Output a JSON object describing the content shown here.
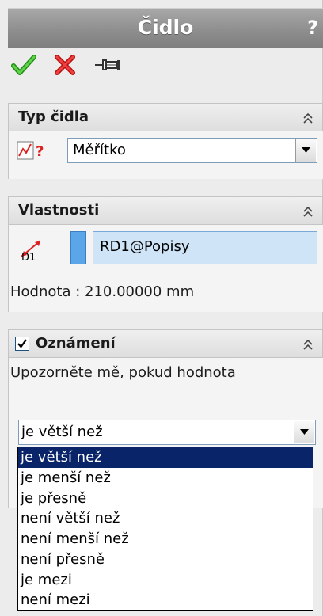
{
  "panel": {
    "title": "Čidlo",
    "help_label": "?"
  },
  "toolbar": {
    "ok_icon": "checkmark-icon",
    "cancel_icon": "x-icon",
    "pin_icon": "pushpin-icon"
  },
  "sensor_type": {
    "header": "Typ čidla",
    "icon": "sensor-graph-icon",
    "selected": "Měřítko"
  },
  "properties": {
    "header": "Vlastnosti",
    "dimension_icon": "dimension-icon",
    "dimension_icon_label": "D1",
    "dimension_value": "RD1@Popisy",
    "value_text": "Hodnota : 210.00000 mm"
  },
  "notification": {
    "header": "Oznámení",
    "checked": true,
    "description": "Upozorněte mě, pokud hodnota",
    "condition_selected": "je větší než",
    "options": [
      "je větší než",
      "je menší než",
      "je přesně",
      "není větší než",
      "není menší než",
      "není přesně",
      "je mezi",
      "není mezi"
    ]
  },
  "colors": {
    "selection": "#0a246a",
    "title_bar": "#8f8f8f",
    "ok_green": "#2eaa1e",
    "cancel_red": "#d01818",
    "field_blue": "#cfe4f7"
  }
}
